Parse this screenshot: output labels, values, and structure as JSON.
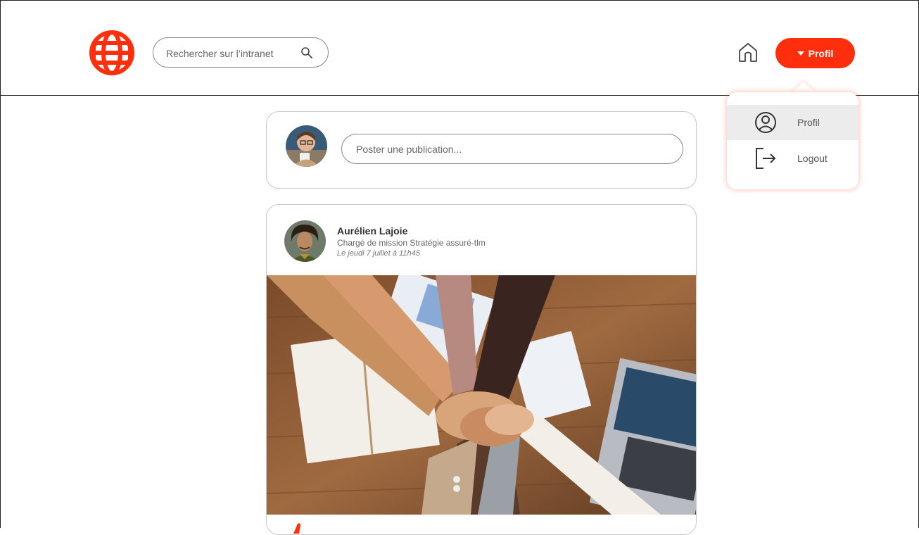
{
  "header": {
    "logo": "globe-logo-icon",
    "search": {
      "placeholder": "Rechercher sur l’intranet",
      "value": ""
    },
    "home_icon": "home-icon",
    "profile_button": "Profil"
  },
  "dropdown": {
    "items": [
      {
        "label": "Profil",
        "icon": "user-circle-icon",
        "active": true
      },
      {
        "label": "Logout",
        "icon": "logout-icon",
        "active": false
      }
    ]
  },
  "composer": {
    "placeholder": "Poster une publication..."
  },
  "post": {
    "author": "Aurélien Lajoie",
    "role": "Chargé de mission Stratégie assuré-tlm",
    "date": "Le jeudi 7 juillet à 11h45"
  },
  "colors": {
    "accent": "#ff2e0c",
    "border": "#c9c9c9"
  }
}
